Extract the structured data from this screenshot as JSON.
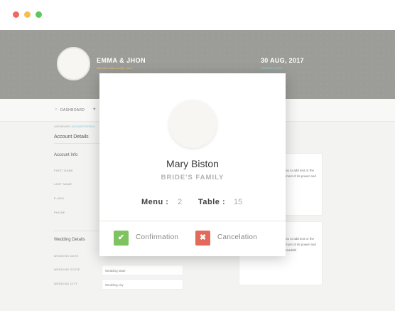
{
  "colors": {
    "accent_teal": "#7fcfdc",
    "accent_gold": "#f5c46a",
    "confirm_green": "#7ec35f",
    "cancel_red": "#e36a5a"
  },
  "window": {
    "controls": [
      "close-dot",
      "minimize-dot",
      "maximize-dot"
    ]
  },
  "header": {
    "couple_names": "EMMA & JHON",
    "couple_subtitle": "Welcome back couple, user!",
    "wedding_date": "30 AUG, 2017",
    "wedding_date_label": "WEDDING DATE"
  },
  "nav": {
    "items": [
      "DASHBOARD"
    ]
  },
  "background_page": {
    "breadcrumb_root": "DASHBOARD",
    "breadcrumb_current": "ACCOUNT DETAILS",
    "account_details_title": "Account Details",
    "account_info_title": "Account Info",
    "account_fields": [
      "FIRST NAME",
      "LAST NAME",
      "E-MAIL",
      "PHONE"
    ],
    "wedding_details_title": "Wedding Details",
    "wedding_fields": [
      "WEDDING DATE",
      "WEDDING STATE",
      "WEDDING CITY"
    ],
    "wedding_inputs": [
      "Wedding state",
      "Wedding city"
    ],
    "card_text_1": "ou to add text or the most of its power and",
    "card_text_2": "ou to add text or the most of its power and readabl",
    "buttons_label": "BUTTONS"
  },
  "modal": {
    "guest_name": "Mary Biston",
    "guest_family": "BRIDE'S FAMILY",
    "menu_label": "Menu :",
    "menu_value": "2",
    "table_label": "Table :",
    "table_value": "15",
    "confirm_icon": "checkmark-icon",
    "confirm_label": "Confirmation",
    "cancel_icon": "x-icon",
    "cancel_label": "Cancelation"
  }
}
